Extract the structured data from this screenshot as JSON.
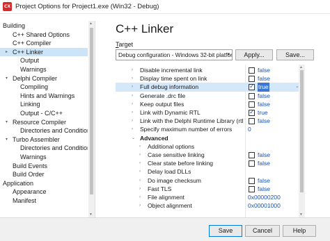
{
  "window": {
    "title": "Project Options for Project1.exe  (Win32 - Debug)",
    "app_icon": "CX"
  },
  "tree": [
    {
      "label": "Building",
      "indent": 0,
      "arrow": ""
    },
    {
      "label": "C++ Shared Options",
      "indent": 1,
      "arrow": ""
    },
    {
      "label": "C++ Compiler",
      "indent": 1,
      "arrow": ""
    },
    {
      "label": "C++ Linker",
      "indent": 1,
      "arrow": "▸",
      "selected": true
    },
    {
      "label": "Output",
      "indent": 2,
      "arrow": ""
    },
    {
      "label": "Warnings",
      "indent": 2,
      "arrow": ""
    },
    {
      "label": "Delphi Compiler",
      "indent": 1,
      "arrow": "▾"
    },
    {
      "label": "Compiling",
      "indent": 2,
      "arrow": ""
    },
    {
      "label": "Hints and Warnings",
      "indent": 2,
      "arrow": ""
    },
    {
      "label": "Linking",
      "indent": 2,
      "arrow": ""
    },
    {
      "label": "Output - C/C++",
      "indent": 2,
      "arrow": ""
    },
    {
      "label": "Resource Compiler",
      "indent": 1,
      "arrow": "▾"
    },
    {
      "label": "Directories and Conditionals",
      "indent": 2,
      "arrow": ""
    },
    {
      "label": "Turbo Assembler",
      "indent": 1,
      "arrow": "▾"
    },
    {
      "label": "Directories and Conditionals",
      "indent": 2,
      "arrow": ""
    },
    {
      "label": "Warnings",
      "indent": 2,
      "arrow": ""
    },
    {
      "label": "Build Events",
      "indent": 1,
      "arrow": ""
    },
    {
      "label": "Build Order",
      "indent": 1,
      "arrow": ""
    },
    {
      "label": "Application",
      "indent": 0,
      "arrow": ""
    },
    {
      "label": "Appearance",
      "indent": 1,
      "arrow": ""
    },
    {
      "label": "Manifest",
      "indent": 1,
      "arrow": ""
    }
  ],
  "main": {
    "title": "C++ Linker",
    "target_label_underlined": "T",
    "target_label_rest": "arget",
    "target_value": "Debug configuration - Windows 32-bit platfor",
    "apply_label": "Apply...",
    "save_label": "Save..."
  },
  "grid": [
    {
      "name": "Disable incremental link",
      "type": "check",
      "checked": false,
      "value": "false",
      "level": 0,
      "expander": "›"
    },
    {
      "name": "Display time spent on link",
      "type": "check",
      "checked": false,
      "value": "false",
      "level": 0,
      "expander": "›"
    },
    {
      "name": "Full debug information",
      "type": "check",
      "checked": true,
      "value": "true",
      "level": 0,
      "expander": "›",
      "highlight": true,
      "dropdown": "⌄"
    },
    {
      "name": "Generate .drc file",
      "type": "check",
      "checked": false,
      "value": "false",
      "level": 0,
      "expander": "›"
    },
    {
      "name": "Keep output files",
      "type": "check",
      "checked": false,
      "value": "false",
      "level": 0,
      "expander": "›"
    },
    {
      "name": "Link with Dynamic RTL",
      "type": "check",
      "checked": true,
      "value": "true",
      "level": 0,
      "expander": "›"
    },
    {
      "name": "Link with the Delphi Runtime Library (rtl pack",
      "type": "check",
      "checked": false,
      "value": "false",
      "level": 0,
      "expander": "›"
    },
    {
      "name": "Specify maximum number of errors",
      "type": "text",
      "value": "0",
      "level": 0,
      "expander": "›"
    },
    {
      "name": "Advanced",
      "type": "group",
      "level": 0,
      "expander": "⌄"
    },
    {
      "name": "Additional options",
      "type": "none",
      "level": 1,
      "expander": "›"
    },
    {
      "name": "Case sensitive linking",
      "type": "check",
      "checked": false,
      "value": "false",
      "level": 1,
      "expander": "›"
    },
    {
      "name": "Clear state before linking",
      "type": "check",
      "checked": false,
      "value": "false",
      "level": 1,
      "expander": "›"
    },
    {
      "name": "Delay load DLLs",
      "type": "none",
      "level": 1,
      "expander": "›"
    },
    {
      "name": "Do image checksum",
      "type": "check",
      "checked": false,
      "value": "false",
      "level": 1,
      "expander": "›"
    },
    {
      "name": "Fast TLS",
      "type": "check",
      "checked": false,
      "value": "false",
      "level": 1,
      "expander": "›"
    },
    {
      "name": "File alignment",
      "type": "text",
      "value": "0x00000200",
      "level": 1,
      "expander": "›"
    },
    {
      "name": "Object alignment",
      "type": "text",
      "value": "0x00001000",
      "level": 1,
      "expander": "›"
    }
  ],
  "footer": {
    "save": "Save",
    "cancel": "Cancel",
    "help": "Help"
  }
}
